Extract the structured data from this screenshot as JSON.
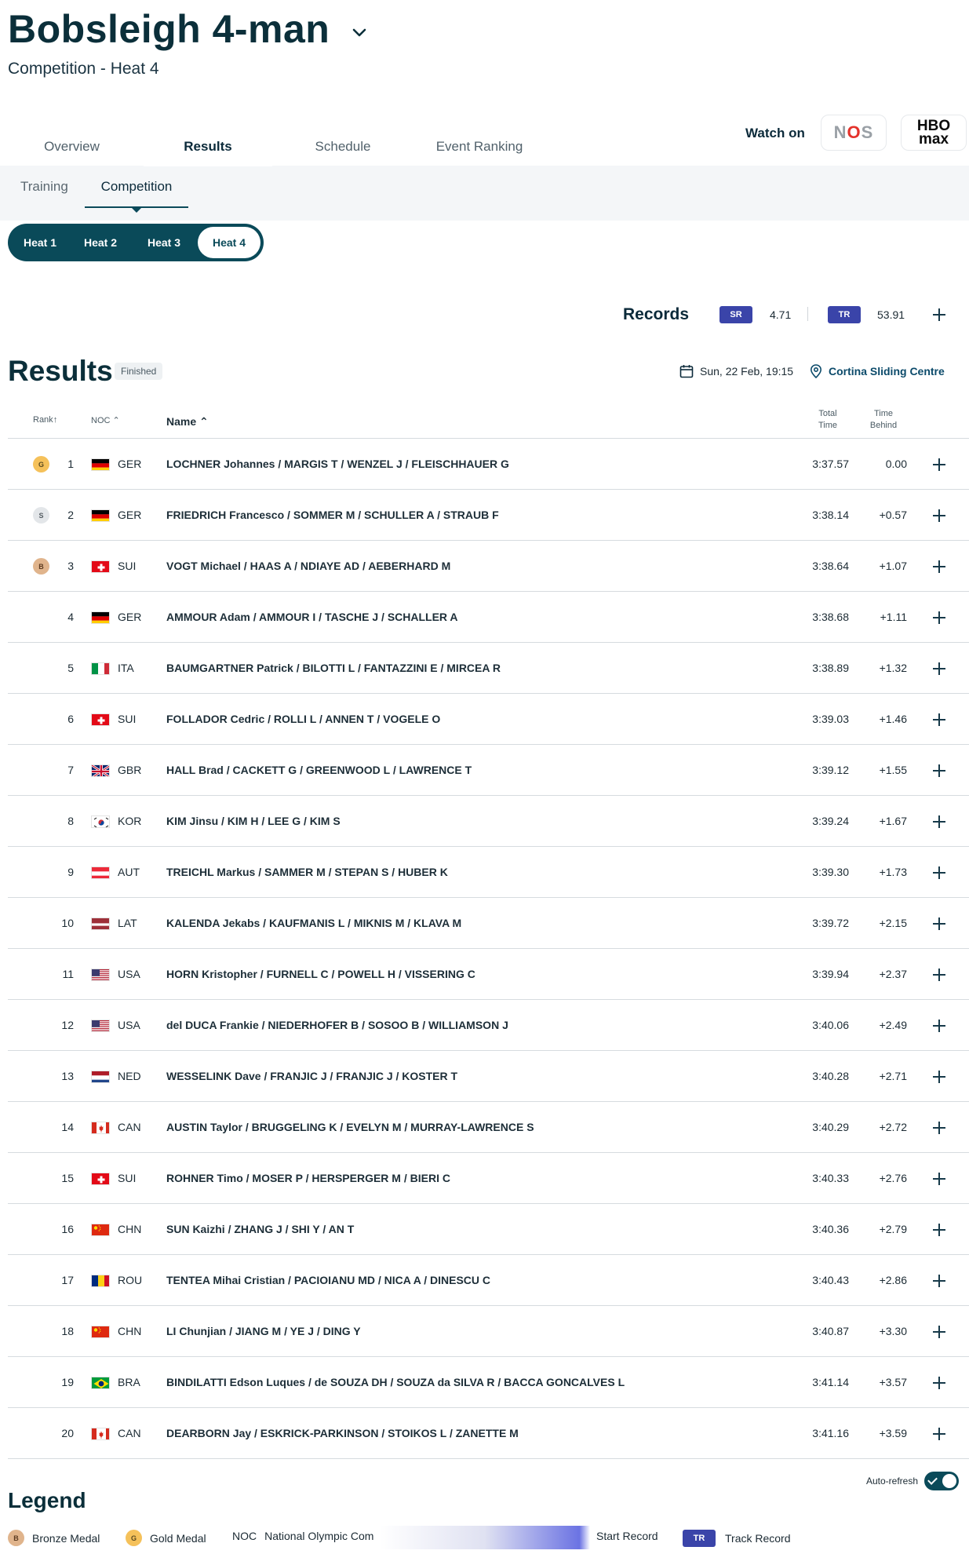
{
  "header": {
    "title": "Bobsleigh 4-man",
    "subtitle": "Competition - Heat 4"
  },
  "tabs": [
    {
      "label": "Overview"
    },
    {
      "label": "Results"
    },
    {
      "label": "Schedule"
    },
    {
      "label": "Event Ranking"
    }
  ],
  "watch": {
    "label": "Watch on",
    "brand1": "NOS",
    "brand2_line1": "HBO",
    "brand2_line2": "max"
  },
  "subtabs": [
    {
      "label": "Training"
    },
    {
      "label": "Competition"
    }
  ],
  "heats": [
    {
      "label": "Heat 1"
    },
    {
      "label": "Heat 2"
    },
    {
      "label": "Heat 3"
    },
    {
      "label": "Heat 4"
    }
  ],
  "records": {
    "label": "Records",
    "sr_badge": "SR",
    "sr_value": "4.71",
    "tr_badge": "TR",
    "tr_value": "53.91"
  },
  "results": {
    "title": "Results",
    "status": "Finished",
    "date": "Sun, 22 Feb, 19:15",
    "venue": "Cortina Sliding Centre"
  },
  "table": {
    "headers": {
      "rank": "Rank",
      "noc": "NOC",
      "name": "Name",
      "total_line1": "Total",
      "total_line2": "Time",
      "behind_line1": "Time",
      "behind_line2": "Behind"
    },
    "rows": [
      {
        "medal": "G",
        "rank": "1",
        "flag": "GER",
        "noc": "GER",
        "name": "LOCHNER Johannes / MARGIS T / WENZEL J / FLEISCHHAUER G",
        "total": "3:37.57",
        "behind": "0.00"
      },
      {
        "medal": "S",
        "rank": "2",
        "flag": "GER",
        "noc": "GER",
        "name": "FRIEDRICH Francesco / SOMMER M / SCHULLER A / STRAUB F",
        "total": "3:38.14",
        "behind": "+0.57"
      },
      {
        "medal": "B",
        "rank": "3",
        "flag": "SUI",
        "noc": "SUI",
        "name": "VOGT Michael / HAAS A / NDIAYE AD / AEBERHARD M",
        "total": "3:38.64",
        "behind": "+1.07"
      },
      {
        "medal": "",
        "rank": "4",
        "flag": "GER",
        "noc": "GER",
        "name": "AMMOUR Adam / AMMOUR I / TASCHE J / SCHALLER A",
        "total": "3:38.68",
        "behind": "+1.11"
      },
      {
        "medal": "",
        "rank": "5",
        "flag": "ITA",
        "noc": "ITA",
        "name": "BAUMGARTNER Patrick / BILOTTI L / FANTAZZINI E / MIRCEA R",
        "total": "3:38.89",
        "behind": "+1.32"
      },
      {
        "medal": "",
        "rank": "6",
        "flag": "SUI",
        "noc": "SUI",
        "name": "FOLLADOR Cedric / ROLLI L / ANNEN T / VOGELE O",
        "total": "3:39.03",
        "behind": "+1.46"
      },
      {
        "medal": "",
        "rank": "7",
        "flag": "GBR",
        "noc": "GBR",
        "name": "HALL Brad / CACKETT G / GREENWOOD L / LAWRENCE T",
        "total": "3:39.12",
        "behind": "+1.55"
      },
      {
        "medal": "",
        "rank": "8",
        "flag": "KOR",
        "noc": "KOR",
        "name": "KIM Jinsu / KIM H / LEE G / KIM S",
        "total": "3:39.24",
        "behind": "+1.67"
      },
      {
        "medal": "",
        "rank": "9",
        "flag": "AUT",
        "noc": "AUT",
        "name": "TREICHL Markus / SAMMER M / STEPAN S / HUBER K",
        "total": "3:39.30",
        "behind": "+1.73"
      },
      {
        "medal": "",
        "rank": "10",
        "flag": "LAT",
        "noc": "LAT",
        "name": "KALENDA Jekabs / KAUFMANIS L / MIKNIS M / KLAVA M",
        "total": "3:39.72",
        "behind": "+2.15"
      },
      {
        "medal": "",
        "rank": "11",
        "flag": "USA",
        "noc": "USA",
        "name": "HORN Kristopher / FURNELL C / POWELL H / VISSERING C",
        "total": "3:39.94",
        "behind": "+2.37"
      },
      {
        "medal": "",
        "rank": "12",
        "flag": "USA",
        "noc": "USA",
        "name": "del DUCA Frankie / NIEDERHOFER B / SOSOO B / WILLIAMSON J",
        "total": "3:40.06",
        "behind": "+2.49"
      },
      {
        "medal": "",
        "rank": "13",
        "flag": "NED",
        "noc": "NED",
        "name": "WESSELINK Dave / FRANJIC J / FRANJIC J / KOSTER T",
        "total": "3:40.28",
        "behind": "+2.71"
      },
      {
        "medal": "",
        "rank": "14",
        "flag": "CAN",
        "noc": "CAN",
        "name": "AUSTIN Taylor / BRUGGELING K / EVELYN M / MURRAY-LAWRENCE S",
        "total": "3:40.29",
        "behind": "+2.72"
      },
      {
        "medal": "",
        "rank": "15",
        "flag": "SUI",
        "noc": "SUI",
        "name": "ROHNER Timo / MOSER P / HERSPERGER M / BIERI C",
        "total": "3:40.33",
        "behind": "+2.76"
      },
      {
        "medal": "",
        "rank": "16",
        "flag": "CHN",
        "noc": "CHN",
        "name": "SUN Kaizhi / ZHANG J / SHI Y / AN T",
        "total": "3:40.36",
        "behind": "+2.79"
      },
      {
        "medal": "",
        "rank": "17",
        "flag": "ROU",
        "noc": "ROU",
        "name": "TENTEA Mihai Cristian / PACIOIANU MD / NICA A / DINESCU C",
        "total": "3:40.43",
        "behind": "+2.86"
      },
      {
        "medal": "",
        "rank": "18",
        "flag": "CHN",
        "noc": "CHN",
        "name": "LI Chunjian / JIANG M / YE J / DING Y",
        "total": "3:40.87",
        "behind": "+3.30"
      },
      {
        "medal": "",
        "rank": "19",
        "flag": "BRA",
        "noc": "BRA",
        "name": "BINDILATTI Edson Luques / de SOUZA DH / SOUZA da SILVA R / BACCA GONCALVES L",
        "total": "3:41.14",
        "behind": "+3.57"
      },
      {
        "medal": "",
        "rank": "20",
        "flag": "CAN",
        "noc": "CAN",
        "name": "DEARBORN Jay / ESKRICK-PARKINSON / STOIKOS L / ZANETTE M",
        "total": "3:41.16",
        "behind": "+3.59"
      }
    ]
  },
  "autorefresh": {
    "label": "Auto-refresh",
    "on": true
  },
  "legend": {
    "title": "Legend",
    "bronze_badge": "B",
    "bronze_label": "Bronze Medal",
    "gold_badge": "G",
    "gold_label": "Gold Medal",
    "noc_abbr": "NOC",
    "noc_label": "National Olympic Com",
    "sr_label": "Start Record",
    "tr_badge": "TR",
    "tr_label": "Track Record"
  },
  "colors": {
    "accent": "#0a4a59",
    "record_badge": "#3a44a9",
    "gold": "#f5c15a",
    "silver": "#e3e6e9",
    "bronze": "#e0b48c"
  },
  "icons": {
    "title_dropdown": "chevron-down-icon",
    "date": "calendar-icon",
    "venue": "location-pin-icon",
    "expand": "plus-icon"
  }
}
